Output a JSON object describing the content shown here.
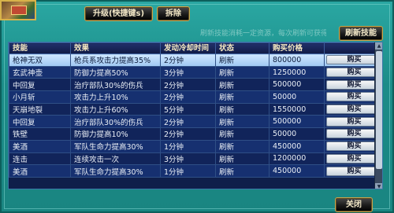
{
  "toolbar": {
    "upgrade_label": "升级(快捷键s)",
    "remove_label": "拆除",
    "refresh_label": "刷新技能",
    "hint_text": "刷新技能消耗一定资源，每次刷新可获得新技能",
    "close_label": "关闭"
  },
  "table": {
    "headers": [
      "技能",
      "效果",
      "发动冷却时间",
      "状态",
      "购买价格",
      ""
    ],
    "buy_label": "购买",
    "rows": [
      {
        "skill": "枪神无双",
        "effect": "枪兵系攻击力提高35%",
        "cooldown": "2分钟",
        "status": "刷新",
        "price": "800000",
        "selected": true
      },
      {
        "skill": "玄武神壶",
        "effect": "防御力提高50%",
        "cooldown": "3分钟",
        "status": "刷新",
        "price": "1250000",
        "selected": false
      },
      {
        "skill": "中回复",
        "effect": "治疗部队30%的伤兵",
        "cooldown": "2分钟",
        "status": "刷新",
        "price": "500000",
        "selected": false
      },
      {
        "skill": "小月斩",
        "effect": "攻击力上升10%",
        "cooldown": "2分钟",
        "status": "刷新",
        "price": "50000",
        "selected": false
      },
      {
        "skill": "天崩地裂",
        "effect": "攻击力上升60%",
        "cooldown": "5分钟",
        "status": "刷新",
        "price": "1550000",
        "selected": false
      },
      {
        "skill": "中回复",
        "effect": "治疗部队30%的伤兵",
        "cooldown": "2分钟",
        "status": "刷新",
        "price": "500000",
        "selected": false
      },
      {
        "skill": "铁壁",
        "effect": "防御力提高10%",
        "cooldown": "2分钟",
        "status": "刷新",
        "price": "50000",
        "selected": false
      },
      {
        "skill": "美酒",
        "effect": "军队生命力提高30%",
        "cooldown": "1分钟",
        "status": "刷新",
        "price": "450000",
        "selected": false
      },
      {
        "skill": "连击",
        "effect": "连续攻击一次",
        "cooldown": "3分钟",
        "status": "刷新",
        "price": "1200000",
        "selected": false
      },
      {
        "skill": "美酒",
        "effect": "军队生命力提高30%",
        "cooldown": "1分钟",
        "status": "刷新",
        "price": "450000",
        "selected": false
      }
    ]
  }
}
